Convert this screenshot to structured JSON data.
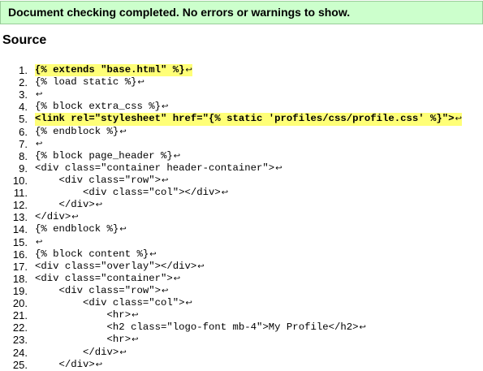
{
  "status": {
    "message": "Document checking completed. No errors or warnings to show."
  },
  "source": {
    "heading": "Source",
    "line_end_marker": "↩",
    "lines": [
      {
        "number": "1.",
        "code": "{% extends \"base.html\" %}",
        "highlighted": true
      },
      {
        "number": "2.",
        "code": "{% load static %}",
        "highlighted": false
      },
      {
        "number": "3.",
        "code": "",
        "highlighted": false
      },
      {
        "number": "4.",
        "code": "{% block extra_css %}",
        "highlighted": false
      },
      {
        "number": "5.",
        "code": "<link rel=\"stylesheet\" href=\"{% static 'profiles/css/profile.css' %}\">",
        "highlighted": true
      },
      {
        "number": "6.",
        "code": "{% endblock %}",
        "highlighted": false
      },
      {
        "number": "7.",
        "code": "",
        "highlighted": false
      },
      {
        "number": "8.",
        "code": "{% block page_header %}",
        "highlighted": false
      },
      {
        "number": "9.",
        "code": "<div class=\"container header-container\">",
        "highlighted": false
      },
      {
        "number": "10.",
        "code": "    <div class=\"row\">",
        "highlighted": false
      },
      {
        "number": "11.",
        "code": "        <div class=\"col\"></div>",
        "highlighted": false
      },
      {
        "number": "12.",
        "code": "    </div>",
        "highlighted": false
      },
      {
        "number": "13.",
        "code": "</div>",
        "highlighted": false
      },
      {
        "number": "14.",
        "code": "{% endblock %}",
        "highlighted": false
      },
      {
        "number": "15.",
        "code": "",
        "highlighted": false
      },
      {
        "number": "16.",
        "code": "{% block content %}",
        "highlighted": false
      },
      {
        "number": "17.",
        "code": "<div class=\"overlay\"></div>",
        "highlighted": false
      },
      {
        "number": "18.",
        "code": "<div class=\"container\">",
        "highlighted": false
      },
      {
        "number": "19.",
        "code": "    <div class=\"row\">",
        "highlighted": false
      },
      {
        "number": "20.",
        "code": "        <div class=\"col\">",
        "highlighted": false
      },
      {
        "number": "21.",
        "code": "            <hr>",
        "highlighted": false
      },
      {
        "number": "22.",
        "code": "            <h2 class=\"logo-font mb-4\">My Profile</h2>",
        "highlighted": false
      },
      {
        "number": "23.",
        "code": "            <hr>",
        "highlighted": false
      },
      {
        "number": "24.",
        "code": "        </div>",
        "highlighted": false
      },
      {
        "number": "25.",
        "code": "    </div>",
        "highlighted": false
      }
    ]
  }
}
